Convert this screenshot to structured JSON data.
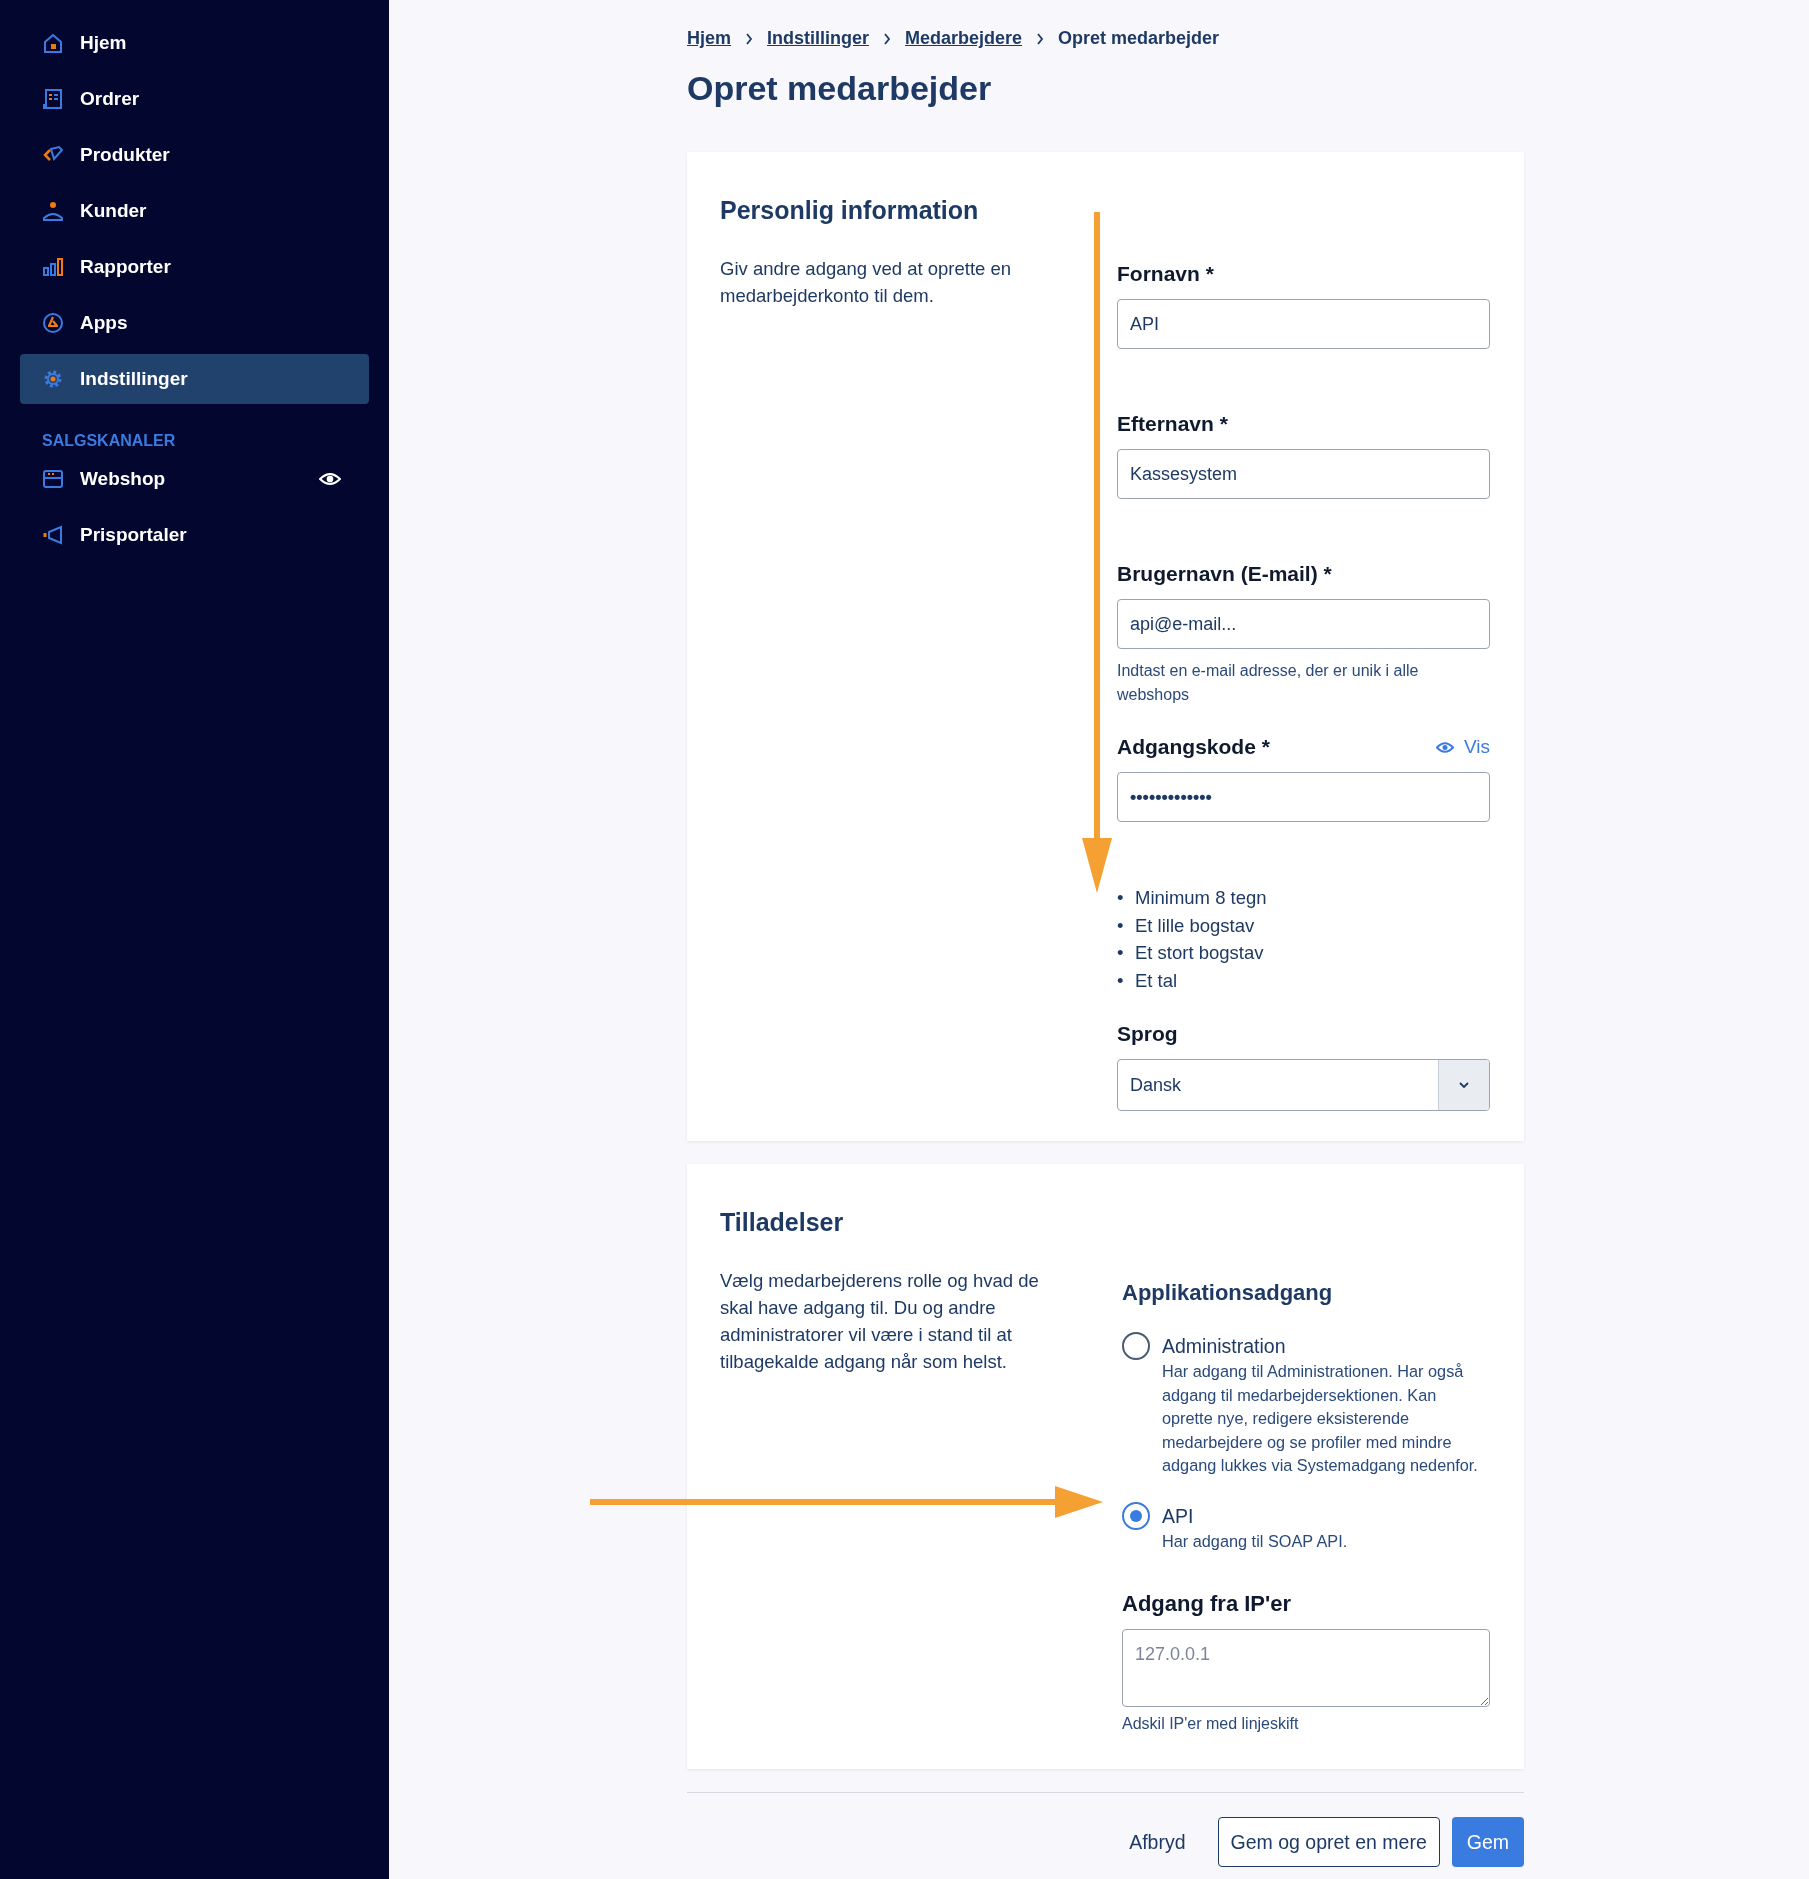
{
  "sidebar": {
    "items": [
      {
        "label": "Hjem",
        "selected": false
      },
      {
        "label": "Ordrer",
        "selected": false
      },
      {
        "label": "Produkter",
        "selected": false
      },
      {
        "label": "Kunder",
        "selected": false
      },
      {
        "label": "Rapporter",
        "selected": false
      },
      {
        "label": "Apps",
        "selected": false
      },
      {
        "label": "Indstillinger",
        "selected": true
      }
    ],
    "section_title": "SALGSKANALER",
    "channels": [
      {
        "label": "Webshop",
        "visible": true
      },
      {
        "label": "Prisportaler",
        "visible": false
      }
    ]
  },
  "breadcrumb": [
    {
      "label": "Hjem",
      "link": true
    },
    {
      "label": "Indstillinger",
      "link": true
    },
    {
      "label": "Medarbejdere",
      "link": true
    },
    {
      "label": "Opret medarbejder",
      "link": false
    }
  ],
  "page_title": "Opret medarbejder",
  "personal": {
    "title": "Personlig information",
    "description": "Giv andre adgang ved at oprette en medarbejderkonto til dem.",
    "fields": [
      {
        "kind": "text",
        "label": "Fornavn *",
        "value": "API"
      },
      {
        "kind": "text",
        "label": "Efternavn *",
        "value": "Kassesystem"
      },
      {
        "kind": "text",
        "label": "Brugernavn (E-mail) *",
        "value": "api@e-mail...",
        "help": "Indtast en e-mail adresse, der er unik i alle webshops"
      },
      {
        "kind": "password",
        "label": "Adgangskode *",
        "value": "•••••••••••••",
        "toggle": "Vis",
        "rules": [
          {
            "bullet": "•",
            "text": "Minimum 8 tegn"
          },
          {
            "bullet": "•",
            "text": "Et lille bogstav"
          },
          {
            "bullet": "•",
            "text": "Et stort bogstav"
          },
          {
            "bullet": "•",
            "text": "Et tal"
          }
        ]
      },
      {
        "kind": "select",
        "label": "Sprog",
        "value": "Dansk"
      }
    ]
  },
  "permissions": {
    "title": "Tilladelser",
    "description": "Vælg medarbejderens rolle og hvad de skal have adgang til. Du og andre administratorer vil være i stand til at tilbagekalde adgang når som helst.",
    "access_title": "Applikationsadgang",
    "options": [
      {
        "label": "Administration",
        "description": "Har adgang til Administrationen. Har også adgang til medarbejdersektionen. Kan oprette nye, redigere eksisterende medarbejdere og se profiler med mindre adgang lukkes via Systemadgang nedenfor.",
        "selected": false
      },
      {
        "label": "API",
        "description": "Har adgang til SOAP API.",
        "selected": true
      }
    ],
    "ip": {
      "label": "Adgang fra IP'er",
      "placeholder": "127.0.0.1",
      "help": "Adskil IP'er med linjeskift"
    }
  },
  "annotations": [
    {
      "kind": "arrow"
    },
    {
      "kind": "arrow"
    }
  ],
  "actions": [
    {
      "kind": "plain",
      "label": "Afbryd"
    },
    {
      "kind": "outline",
      "label": "Gem og opret en mere"
    },
    {
      "kind": "primary",
      "label": "Gem"
    }
  ]
}
